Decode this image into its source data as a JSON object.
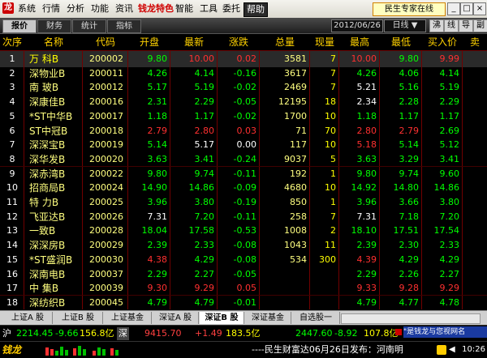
{
  "menu": {
    "items": [
      "系统",
      "行情",
      "分析",
      "功能",
      "资讯",
      "钱龙特色",
      "智能",
      "工具",
      "委托",
      "帮助"
    ],
    "promo": "民生专家在线",
    "win_buttons": [
      "_",
      "□",
      "×"
    ]
  },
  "toolbar": {
    "tabs": [
      "报价",
      "财务",
      "统计",
      "指标"
    ],
    "date": "2012/06/26",
    "period": "日线 ▼",
    "right_buttons": [
      "沸",
      "线",
      "导",
      "副"
    ]
  },
  "table": {
    "headers": [
      "次序",
      "名称",
      "代码",
      "开盘",
      "最新",
      "涨跌",
      "总量",
      "现量",
      "最高",
      "最低",
      "买入价",
      "卖"
    ],
    "rows": [
      {
        "idx": "1",
        "name": "万 科B",
        "code": "200002",
        "open": "9.80",
        "last": "10.00",
        "chg": "0.02",
        "vol": "3581",
        "cur": "7",
        "high": "10.00",
        "low": "9.80",
        "bid": "9.99"
      },
      {
        "idx": "2",
        "name": "深物业B",
        "code": "200011",
        "open": "4.26",
        "last": "4.14",
        "chg": "-0.16",
        "vol": "3617",
        "cur": "7",
        "high": "4.26",
        "low": "4.06",
        "bid": "4.14"
      },
      {
        "idx": "3",
        "name": "南 玻B",
        "code": "200012",
        "open": "5.17",
        "last": "5.19",
        "chg": "-0.02",
        "vol": "2469",
        "cur": "7",
        "high": "5.21",
        "low": "5.16",
        "bid": "5.19"
      },
      {
        "idx": "4",
        "name": "深康佳B",
        "code": "200016",
        "open": "2.31",
        "last": "2.29",
        "chg": "-0.05",
        "vol": "12195",
        "cur": "18",
        "high": "2.34",
        "low": "2.28",
        "bid": "2.29"
      },
      {
        "idx": "5",
        "name": "*ST中华B",
        "code": "200017",
        "open": "1.18",
        "last": "1.17",
        "chg": "-0.02",
        "vol": "1700",
        "cur": "10",
        "high": "1.18",
        "low": "1.17",
        "bid": "1.17"
      },
      {
        "idx": "6",
        "name": "ST中冠B",
        "code": "200018",
        "open": "2.79",
        "last": "2.80",
        "chg": "0.03",
        "vol": "71",
        "cur": "70",
        "high": "2.80",
        "low": "2.79",
        "bid": "2.69"
      },
      {
        "idx": "7",
        "name": "深深宝B",
        "code": "200019",
        "open": "5.14",
        "last": "5.17",
        "chg": "0.00",
        "vol": "117",
        "cur": "10",
        "high": "5.18",
        "low": "5.14",
        "bid": "5.12"
      },
      {
        "idx": "8",
        "name": "深华发B",
        "code": "200020",
        "open": "3.63",
        "last": "3.41",
        "chg": "-0.24",
        "vol": "9037",
        "cur": "5",
        "high": "3.63",
        "low": "3.29",
        "bid": "3.41"
      },
      {
        "idx": "9",
        "name": "深赤湾B",
        "code": "200022",
        "open": "9.80",
        "last": "9.74",
        "chg": "-0.11",
        "vol": "192",
        "cur": "1",
        "high": "9.80",
        "low": "9.74",
        "bid": "9.60"
      },
      {
        "idx": "10",
        "name": "招商局B",
        "code": "200024",
        "open": "14.90",
        "last": "14.86",
        "chg": "-0.09",
        "vol": "4680",
        "cur": "10",
        "high": "14.92",
        "low": "14.80",
        "bid": "14.86"
      },
      {
        "idx": "11",
        "name": "特 力B",
        "code": "200025",
        "open": "3.96",
        "last": "3.80",
        "chg": "-0.19",
        "vol": "850",
        "cur": "1",
        "high": "3.96",
        "low": "3.66",
        "bid": "3.80"
      },
      {
        "idx": "12",
        "name": "飞亚达B",
        "code": "200026",
        "open": "7.31",
        "last": "7.20",
        "chg": "-0.11",
        "vol": "258",
        "cur": "7",
        "high": "7.31",
        "low": "7.18",
        "bid": "7.20"
      },
      {
        "idx": "13",
        "name": "一致B",
        "code": "200028",
        "open": "18.04",
        "last": "17.58",
        "chg": "-0.53",
        "vol": "1008",
        "cur": "2",
        "high": "18.10",
        "low": "17.51",
        "bid": "17.54"
      },
      {
        "idx": "14",
        "name": "深深房B",
        "code": "200029",
        "open": "2.39",
        "last": "2.33",
        "chg": "-0.08",
        "vol": "1043",
        "cur": "11",
        "high": "2.39",
        "low": "2.30",
        "bid": "2.33"
      },
      {
        "idx": "15",
        "name": "*ST盛润B",
        "code": "200030",
        "open": "4.38",
        "last": "4.29",
        "chg": "-0.08",
        "vol": "534",
        "cur": "300",
        "high": "4.39",
        "low": "4.29",
        "bid": "4.29"
      },
      {
        "idx": "16",
        "name": "深南电B",
        "code": "200037",
        "open": "2.29",
        "last": "2.27",
        "chg": "-0.05",
        "vol": "",
        "cur": "",
        "high": "2.29",
        "low": "2.26",
        "bid": "2.27"
      },
      {
        "idx": "17",
        "name": "中 集B",
        "code": "200039",
        "open": "9.30",
        "last": "9.29",
        "chg": "0.05",
        "vol": "",
        "cur": "",
        "high": "9.33",
        "low": "9.28",
        "bid": "9.29"
      },
      {
        "idx": "18",
        "name": "深纺织B",
        "code": "200045",
        "open": "4.79",
        "last": "4.79",
        "chg": "-0.01",
        "vol": "",
        "cur": "",
        "high": "4.79",
        "low": "4.77",
        "bid": "4.78"
      }
    ]
  },
  "bottom_tabs": [
    "上证A 股",
    "上证B 股",
    "上证基金",
    "深证A 股",
    "深证B 股",
    "深证基金",
    "自选股一"
  ],
  "index_bar": {
    "sh_label": "沪",
    "sh_value": "2214.45",
    "sh_chg": "-9.66",
    "sh_amt": "156.8亿",
    "sz_label": "深",
    "sz_value": "9415.70",
    "sz_chg": "+1.49",
    "sz_amt": "183.5亿",
    "ot_value": "2447.60",
    "ot_chg": "-8.92",
    "ot_amt": "107.8亿",
    "news": "\"是钱龙与您视网名",
    "news_icon": "flag-icon"
  },
  "status": {
    "logo": "钱龙",
    "ticker": "----民生财富达06月26日发布：河南明",
    "time": "10:26"
  },
  "colors": {
    "up": "#ff3030",
    "down": "#00ff00",
    "flat": "#ffffff",
    "header": "#ffd200"
  }
}
